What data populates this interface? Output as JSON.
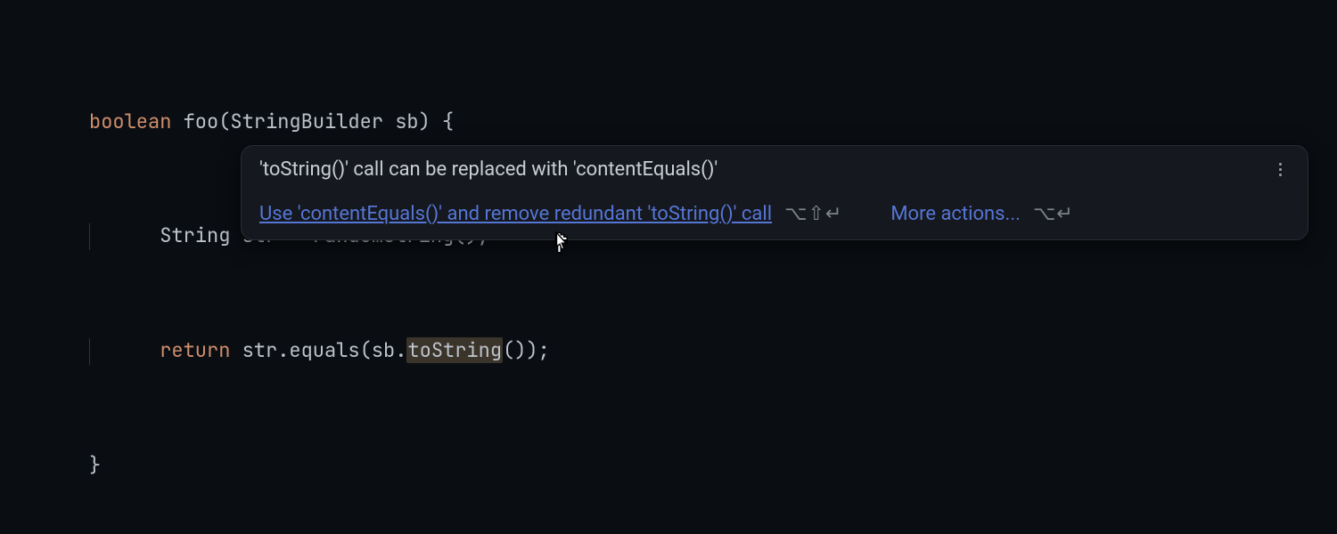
{
  "code": {
    "line1": {
      "kw": "boolean",
      "fn": "foo",
      "params_open": "(",
      "type": "StringBuilder",
      "param": "sb",
      "params_close": ") {"
    },
    "line2": {
      "type": "String",
      "var": "str",
      "eq": " = ",
      "call": "randomString",
      "tail": "();"
    },
    "line3": {
      "kw": "return",
      "expr1": " str.equals(sb.",
      "hl": "toString",
      "expr2": "());"
    },
    "line4": {
      "brace": "}"
    }
  },
  "tooltip": {
    "title": "'toString()' call can be replaced with 'contentEquals()'",
    "primary_action": "Use 'contentEquals()' and remove redundant 'toString()' call",
    "primary_shortcut": "⌥⇧↵",
    "more_actions": "More actions...",
    "more_shortcut": "⌥↵"
  }
}
